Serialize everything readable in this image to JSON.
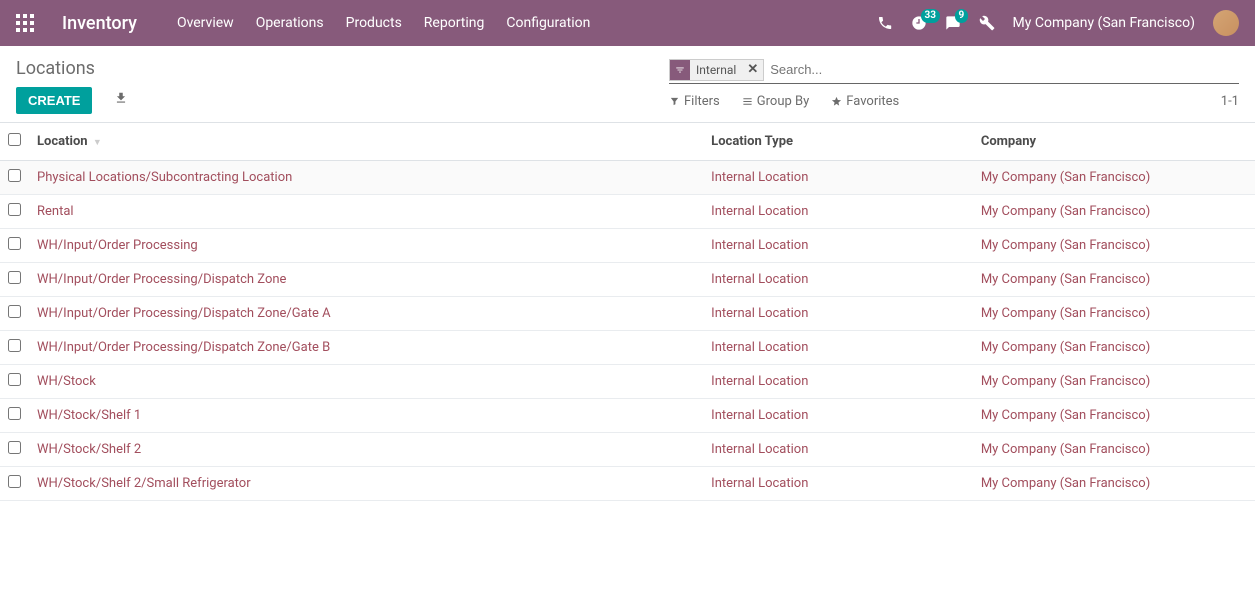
{
  "navbar": {
    "brand": "Inventory",
    "links": [
      "Overview",
      "Operations",
      "Products",
      "Reporting",
      "Configuration"
    ],
    "badge_clock": "33",
    "badge_chat": "9",
    "company": "My Company (San Francisco)"
  },
  "breadcrumb": "Locations",
  "buttons": {
    "create": "Create"
  },
  "search": {
    "facet_label": "Internal",
    "placeholder": "Search..."
  },
  "toolbar": {
    "filters": "Filters",
    "groupby": "Group By",
    "favorites": "Favorites",
    "pager": "1-1"
  },
  "columns": {
    "location": "Location",
    "type": "Location Type",
    "company": "Company"
  },
  "rows": [
    {
      "name": "Physical Locations/Subcontracting Location",
      "type": "Internal Location",
      "company": "My Company (San Francisco)"
    },
    {
      "name": "Rental",
      "type": "Internal Location",
      "company": "My Company (San Francisco)"
    },
    {
      "name": "WH/Input/Order Processing",
      "type": "Internal Location",
      "company": "My Company (San Francisco)"
    },
    {
      "name": "WH/Input/Order Processing/Dispatch Zone",
      "type": "Internal Location",
      "company": "My Company (San Francisco)"
    },
    {
      "name": "WH/Input/Order Processing/Dispatch Zone/Gate A",
      "type": "Internal Location",
      "company": "My Company (San Francisco)"
    },
    {
      "name": "WH/Input/Order Processing/Dispatch Zone/Gate B",
      "type": "Internal Location",
      "company": "My Company (San Francisco)"
    },
    {
      "name": "WH/Stock",
      "type": "Internal Location",
      "company": "My Company (San Francisco)"
    },
    {
      "name": "WH/Stock/Shelf 1",
      "type": "Internal Location",
      "company": "My Company (San Francisco)"
    },
    {
      "name": "WH/Stock/Shelf 2",
      "type": "Internal Location",
      "company": "My Company (San Francisco)"
    },
    {
      "name": "WH/Stock/Shelf 2/Small Refrigerator",
      "type": "Internal Location",
      "company": "My Company (San Francisco)"
    }
  ]
}
